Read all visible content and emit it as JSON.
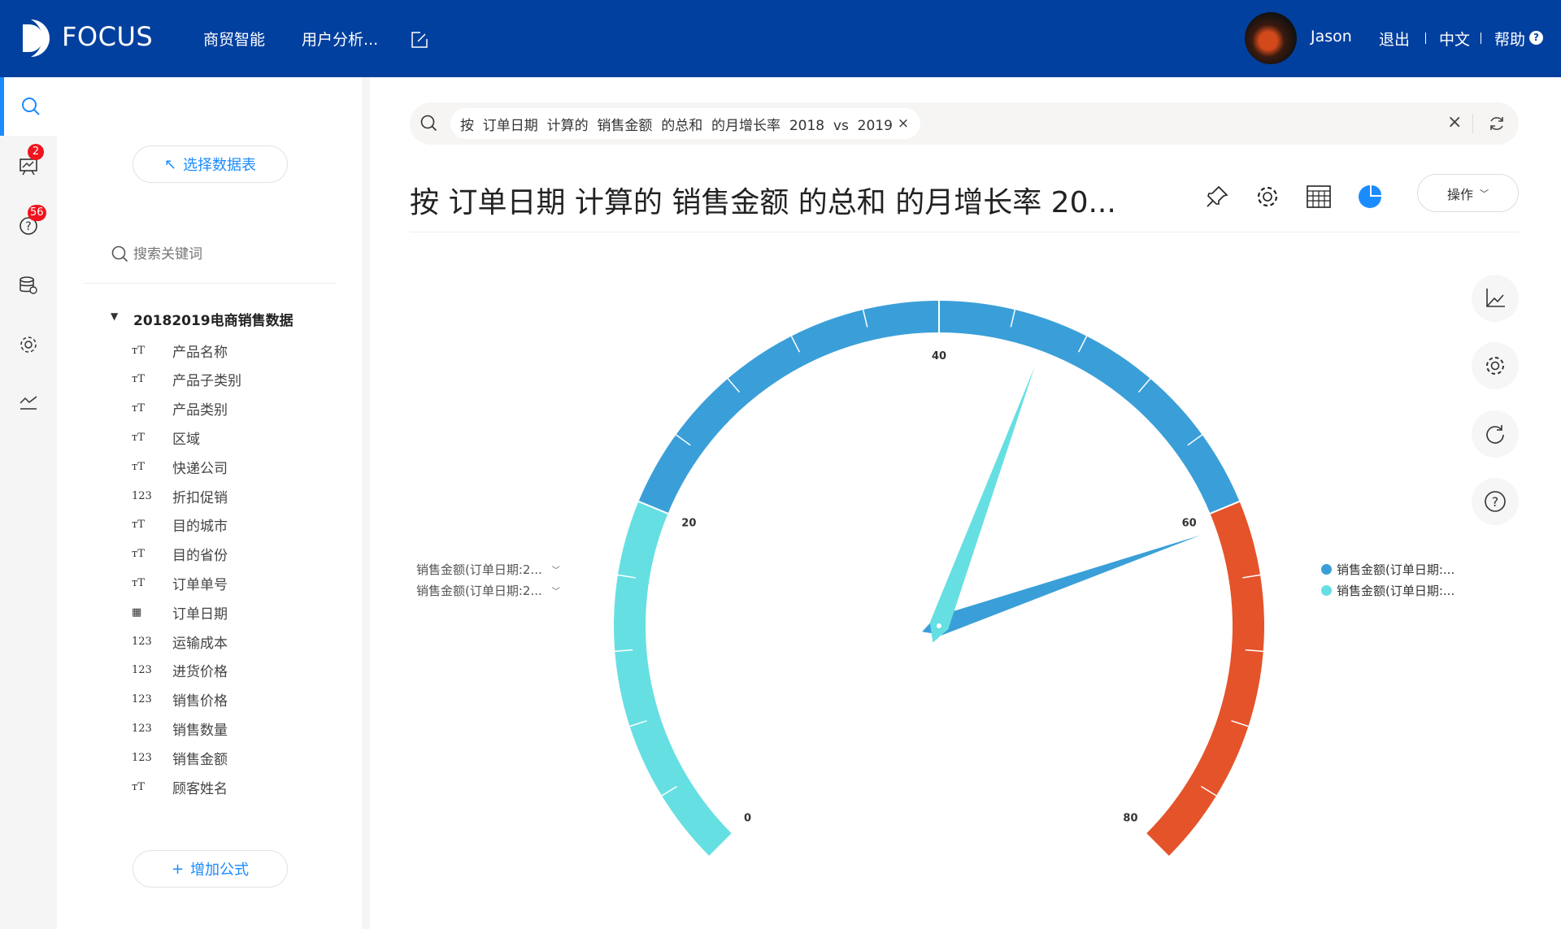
{
  "header": {
    "logo": "FOCUS",
    "nav": [
      "商贸智能",
      "用户分析..."
    ],
    "user": "Jason",
    "logout": "退出",
    "language": "中文",
    "help": "帮助",
    "bg_color": "#02409f"
  },
  "iconbar": {
    "badges": {
      "board": "2",
      "questions": "56"
    }
  },
  "panel": {
    "select_table": "选择数据表",
    "search_placeholder": "搜索关键词",
    "dataset": "20182019电商销售数据",
    "fields": [
      {
        "name": "产品名称",
        "type": "text"
      },
      {
        "name": "产品子类别",
        "type": "text"
      },
      {
        "name": "产品类别",
        "type": "text"
      },
      {
        "name": "区域",
        "type": "text"
      },
      {
        "name": "快递公司",
        "type": "text"
      },
      {
        "name": "折扣促销",
        "type": "number"
      },
      {
        "name": "目的城市",
        "type": "text"
      },
      {
        "name": "目的省份",
        "type": "text"
      },
      {
        "name": "订单单号",
        "type": "text"
      },
      {
        "name": "订单日期",
        "type": "date"
      },
      {
        "name": "运输成本",
        "type": "number"
      },
      {
        "name": "进货价格",
        "type": "number"
      },
      {
        "name": "销售价格",
        "type": "number"
      },
      {
        "name": "销售数量",
        "type": "number"
      },
      {
        "name": "销售金额",
        "type": "number"
      },
      {
        "name": "顾客姓名",
        "type": "text"
      }
    ],
    "add_formula": "增加公式"
  },
  "search": {
    "query": "按  订单日期  计算的  销售金额  的总和  的月增长率  2018  vs  2019"
  },
  "main": {
    "title": "按 订单日期 计算的 销售金额 的总和 的月增长率 20...",
    "ops": "操作",
    "accent": "#1a8cff"
  },
  "legend_left": [
    "销售金额(订单日期:2...",
    "销售金额(订单日期:2..."
  ],
  "legend_right": [
    "销售金额(订单日期:...",
    "销售金额(订单日期:..."
  ],
  "chart_data": {
    "type": "gauge",
    "min": 0,
    "max": 80,
    "tick_labels": [
      "0",
      "20",
      "40",
      "60",
      "80"
    ],
    "bands": [
      {
        "from": 0,
        "to": 20,
        "color": "#66dfe2"
      },
      {
        "from": 20,
        "to": 60,
        "color": "#3a9fd8"
      },
      {
        "from": 60,
        "to": 80,
        "color": "#e5532a"
      }
    ],
    "series": [
      {
        "value": 61,
        "color": "#3a9fd8"
      },
      {
        "value": 46,
        "color": "#66dfe2"
      }
    ]
  }
}
